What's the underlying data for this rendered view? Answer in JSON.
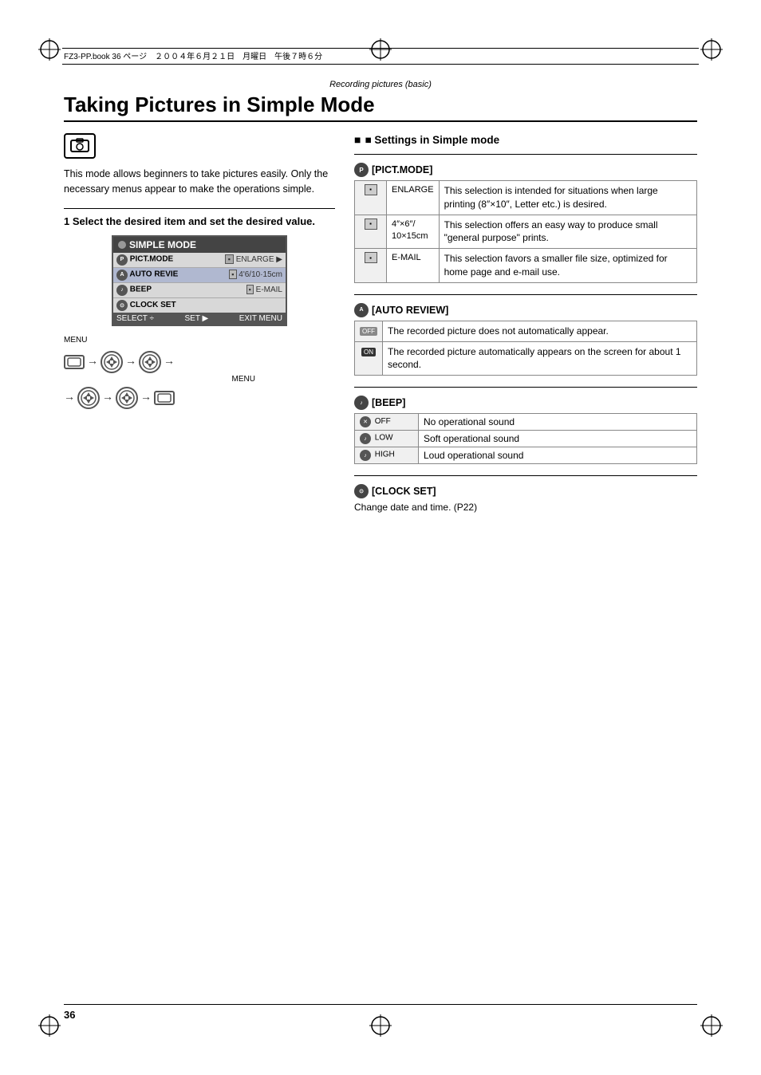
{
  "page": {
    "number": "36",
    "file_info": "FZ3-PP.book  36 ページ　２００４年６月２１日　月曜日　午後７時６分",
    "section_label": "Recording pictures (basic)"
  },
  "title": "Taking Pictures in Simple Mode",
  "left_col": {
    "intro": "This mode allows beginners to take pictures easily. Only the necessary menus appear to make the operations simple.",
    "step1_heading": "1 Select the desired item and set the desired value.",
    "menu_title": "SIMPLE MODE",
    "menu_rows": [
      {
        "icon": "PICT",
        "label": "PICT.MODE",
        "value": "ENLARGE",
        "selected": false
      },
      {
        "icon": "AUTO",
        "label": "AUTO REVIE",
        "value": "4'6/10·15cm",
        "selected": false
      },
      {
        "icon": "BEEP",
        "label": "BEEP",
        "value": "E-MAIL",
        "selected": false
      },
      {
        "icon": "CLK",
        "label": "CLOCK SET",
        "value": "",
        "selected": false
      }
    ],
    "menu_bottom": [
      "SELECT ÷",
      "SET ▶",
      "EXIT MENU"
    ],
    "menu_label_below": "MENU",
    "nav_label": "MENU"
  },
  "right_col": {
    "settings_heading": "■ Settings in Simple mode",
    "sections": [
      {
        "id": "pict_mode",
        "icon_label": "[PICT.MODE]",
        "rows": [
          {
            "icon": "ENLARGE",
            "label": "ENLARGE",
            "desc": "This selection is intended for situations when large printing (8\"×10\", Letter etc.) is desired."
          },
          {
            "icon": "4×6",
            "label": "4\"×6\"/\n10×15cm",
            "desc": "This selection offers an easy way to produce small \"general purpose\" prints."
          },
          {
            "icon": "EMAIL",
            "label": "E-MAIL",
            "desc": "This selection favors a smaller file size, optimized for home page and e-mail use."
          }
        ]
      },
      {
        "id": "auto_review",
        "icon_label": "[AUTO REVIEW]",
        "rows": [
          {
            "icon": "OFF",
            "label": "",
            "desc": "The recorded picture does not automatically appear."
          },
          {
            "icon": "ON",
            "label": "",
            "desc": "The recorded picture automatically appears on the screen for about 1 second."
          }
        ]
      },
      {
        "id": "beep",
        "icon_label": "[BEEP]",
        "rows": [
          {
            "icon_label": "OFF",
            "desc": "No operational sound"
          },
          {
            "icon_label": "LOW",
            "desc": "Soft operational sound"
          },
          {
            "icon_label": "HIGH",
            "desc": "Loud operational sound"
          }
        ]
      },
      {
        "id": "clock_set",
        "icon_label": "[CLOCK SET]",
        "desc": "Change date and time. (P22)"
      }
    ]
  }
}
